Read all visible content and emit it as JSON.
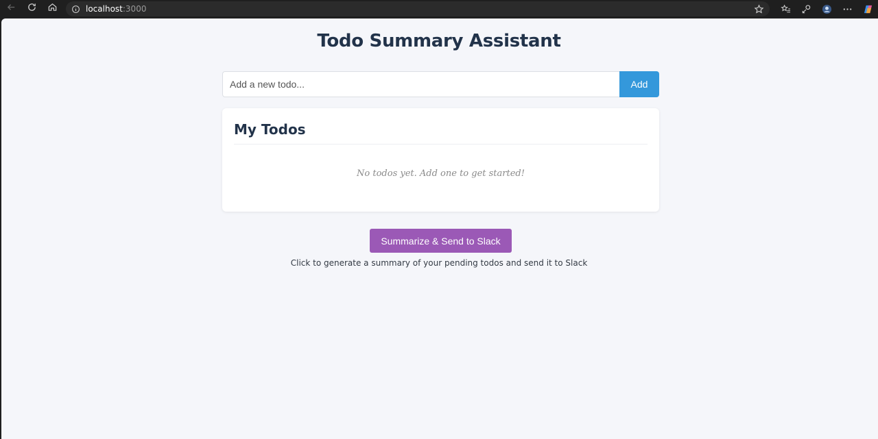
{
  "browser": {
    "url_host": "localhost",
    "url_port": ":3000",
    "icons": [
      "back-icon",
      "refresh-icon",
      "home-icon",
      "site-info-icon",
      "favorite-star-icon",
      "favorites-icon",
      "collections-icon",
      "profile-icon",
      "more-icon",
      "copilot-icon"
    ]
  },
  "page": {
    "title": "Todo Summary Assistant",
    "input_placeholder": "Add a new todo...",
    "input_value": "",
    "add_label": "Add",
    "card_title": "My Todos",
    "empty_message": "No todos yet. Add one to get started!",
    "summarize_label": "Summarize & Send to Slack",
    "hint": "Click to generate a summary of your pending todos and send it to Slack"
  },
  "colors": {
    "background": "#f5f6fa",
    "title": "#22334a",
    "add_button": "#3498db",
    "summarize_button": "#9b59b6"
  }
}
